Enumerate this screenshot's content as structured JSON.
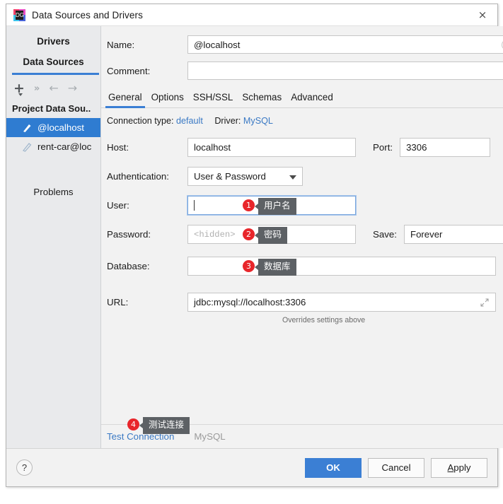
{
  "window": {
    "title": "Data Sources and Drivers",
    "app_icon": "datagrip-icon",
    "close_label": "×"
  },
  "sidebar": {
    "tabs": [
      {
        "label": "Drivers",
        "active": false
      },
      {
        "label": "Data Sources",
        "active": true
      }
    ],
    "toolbar": [
      {
        "name": "add-button",
        "glyph": "+"
      },
      {
        "name": "more-button",
        "glyph": "»"
      },
      {
        "name": "back-button",
        "glyph": "←"
      },
      {
        "name": "forward-button",
        "glyph": "→"
      }
    ],
    "group_title": "Project Data Sou..",
    "items": [
      {
        "label": "@localhost",
        "selected": true
      },
      {
        "label": "rent-car@loc",
        "selected": false
      }
    ],
    "problems_label": "Problems"
  },
  "header": {
    "name_label": "Name:",
    "name_value": "@localhost",
    "comment_label": "Comment:",
    "comment_value": ""
  },
  "tabs": [
    {
      "label": "General",
      "active": true
    },
    {
      "label": "Options",
      "active": false
    },
    {
      "label": "SSH/SSL",
      "active": false
    },
    {
      "label": "Schemas",
      "active": false
    },
    {
      "label": "Advanced",
      "active": false
    }
  ],
  "general": {
    "connection_type_label": "Connection type:",
    "connection_type_value": "default",
    "driver_label": "Driver:",
    "driver_value": "MySQL",
    "host_label": "Host:",
    "host_value": "localhost",
    "port_label": "Port:",
    "port_value": "3306",
    "auth_label": "Authentication:",
    "auth_value": "User & Password",
    "user_label": "User:",
    "user_value": "",
    "password_label": "Password:",
    "password_placeholder": "<hidden>",
    "save_label": "Save:",
    "save_value": "Forever",
    "database_label": "Database:",
    "database_value": "",
    "url_label": "URL:",
    "url_value": "jdbc:mysql://localhost:3306",
    "url_hint": "Overrides settings above"
  },
  "annotations": [
    {
      "number": "1",
      "text": "用户名",
      "target": "user-field"
    },
    {
      "number": "2",
      "text": "密码",
      "target": "password-field"
    },
    {
      "number": "3",
      "text": "数据库",
      "target": "database-field"
    },
    {
      "number": "4",
      "text": "测试连接",
      "target": "test-connection-link"
    }
  ],
  "action_row": {
    "test_connection": "Test Connection",
    "driver_name": "MySQL",
    "revert_icon": "↺"
  },
  "footer": {
    "help": "?",
    "ok": "OK",
    "cancel": "Cancel",
    "apply_prefix": "A",
    "apply_suffix": "pply"
  },
  "colors": {
    "accent": "#3b7fd4",
    "link": "#3a79c4",
    "badge": "#e8262b",
    "tooltip_bg": "#5d6165",
    "selection": "#2f7cd1"
  }
}
